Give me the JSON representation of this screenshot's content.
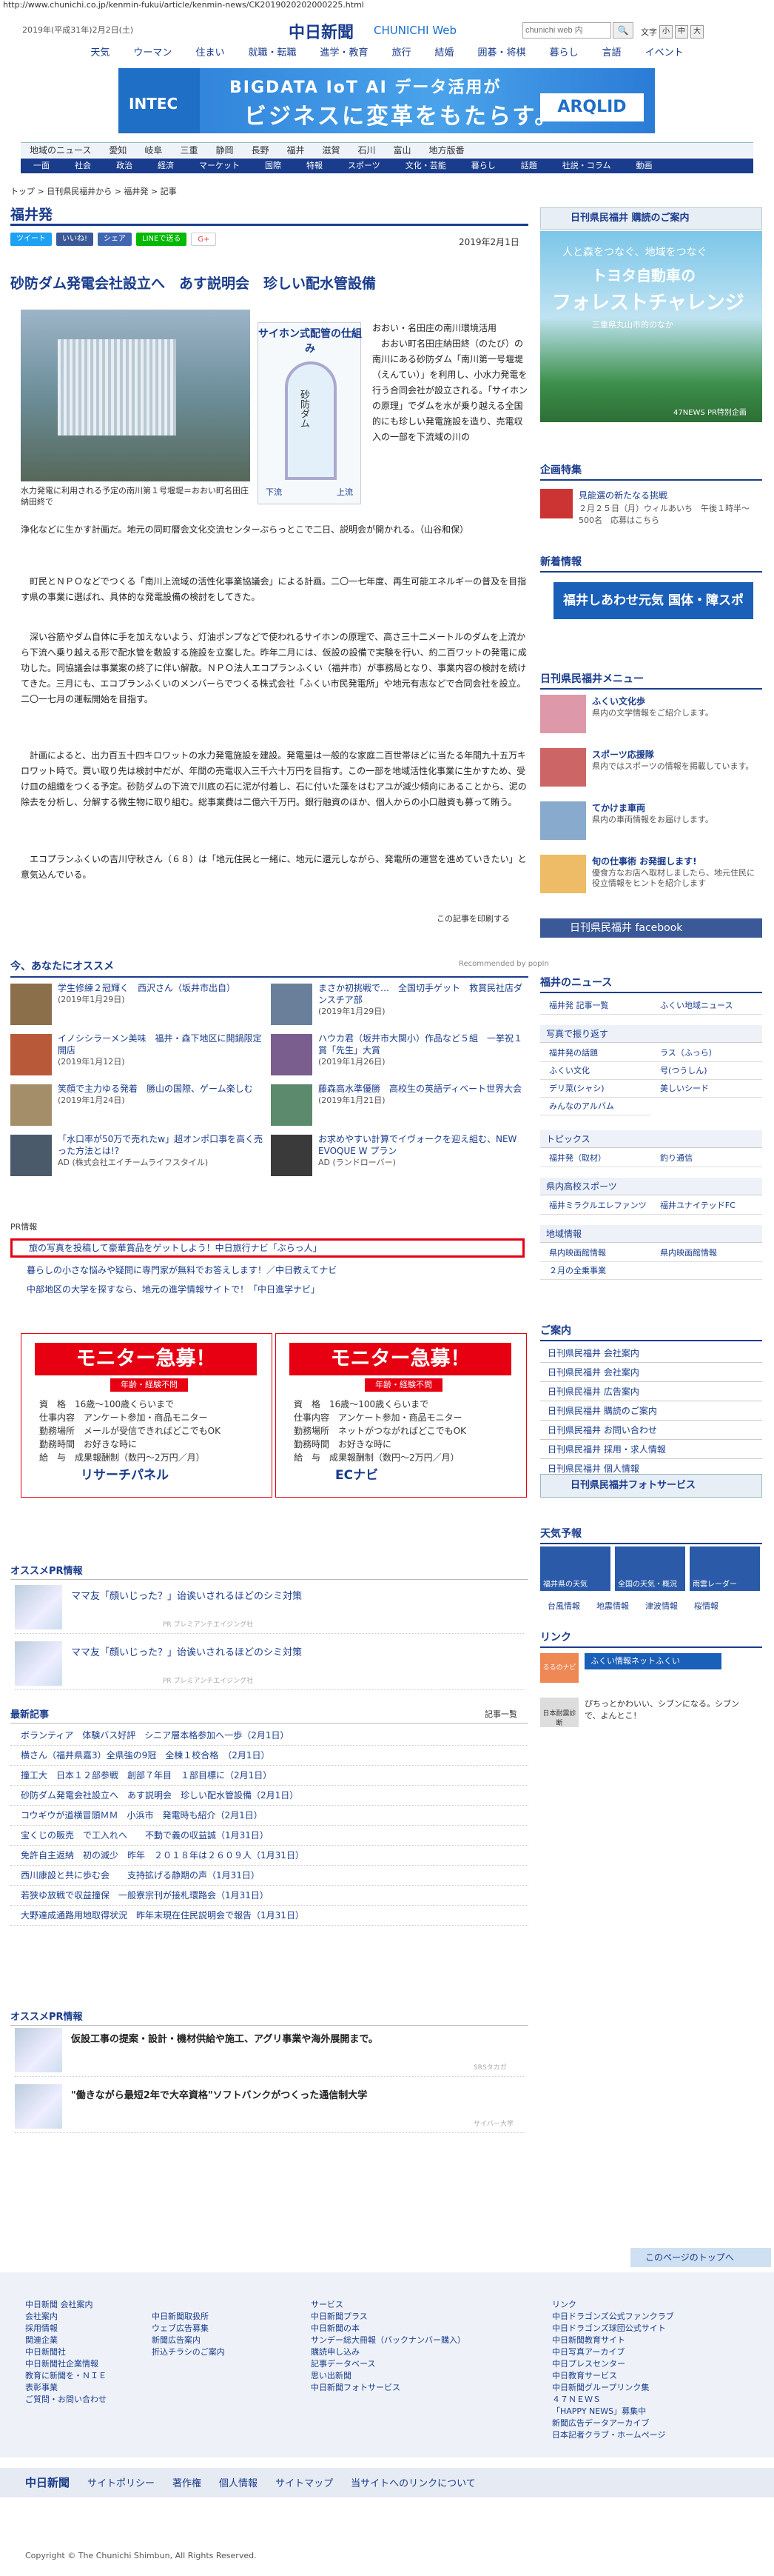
{
  "browser": {
    "url": "http://www.chunichi.co.jp/kenmin-fukui/article/kenmin-news/CK2019020202000225.html"
  },
  "header": {
    "date": "2019年(平成31年)2月2日(土)",
    "logo": "中日新聞",
    "logo_en": "CHUNICHI Web",
    "search_placeholder": "chunichi web 内",
    "search_btn": "🔍",
    "fontsize_label": "文字",
    "fs_small": "小",
    "fs_mid": "中",
    "fs_large": "大"
  },
  "gnav": [
    "天気",
    "ウーマン",
    "住まい",
    "就職・転職",
    "進学・教育",
    "旅行",
    "結婚",
    "囲碁・将棋",
    "暮らし",
    "言語",
    "イベント"
  ],
  "banner": {
    "brand": "INTEC",
    "top": "BIGDATA  IoT  AI データ活用が",
    "big": "ビジネスに変革をもたらす。",
    "arq": "ARQLID"
  },
  "region_nav": [
    "地域のニュース",
    "愛知",
    "岐阜",
    "三重",
    "静岡",
    "長野",
    "福井",
    "滋賀",
    "石川",
    "富山",
    "地方版番"
  ],
  "cat_nav": [
    "一面",
    "社会",
    "政治",
    "経済",
    "マーケット",
    "国際",
    "特報",
    "スポーツ",
    "文化・芸能",
    "暮らし",
    "話題",
    "社説・コラム",
    "動画"
  ],
  "breadcrumb": "トップ > 日刊県民福井から > 福井発 > 記事",
  "section": "福井発",
  "share": [
    "ツイート",
    "いいね!",
    "シェア",
    "LINEで送る",
    "G+"
  ],
  "article": {
    "date": "2019年2月1日",
    "title": "砂防ダム発電会社設立へ　あす説明会　珍しい配水管設備",
    "caption": "水力発電に利用される予定の南川第１号堰堤＝おおい町名田庄納田終で",
    "diagram_title": "サイホン式配管の仕組み",
    "diagram_label": "砂防ダム",
    "diagram_l1": "下流",
    "diagram_l2": "上流",
    "p1_right": "おおい・名田庄の南川環境活用\n　おおい町名田庄納田終（のたび）の南川にある砂防ダム「南川第一号堰堤（えんてい）」を利用し、小水力発電を行う合同会社が設立される。「サイホンの原理」でダムを水が乗り越える全国的にも珍しい発電施設を造り、売電収入の一部を下流域の川の",
    "p1_cont": "浄化などに生かす計画だ。地元の同町暦会文化交流センターぷらっとこで二日、説明会が開かれる。（山谷和保）",
    "p2": "　町民とＮＰＯなどでつくる「南川上流域の活性化事業協議会」による計画。二〇一七年度、再生可能エネルギーの普及を目指す県の事業に選ばれ、具体的な発電設備の検討をしてきた。",
    "p3": "　深い谷筋やダム自体に手を加えないよう、灯油ポンプなどで使われるサイホンの原理で、高さ三十二メートルのダムを上流から下流へ乗り越える形で配水管を敷設する施設を立案した。昨年二月には、仮設の設備で実験を行い、約二百ワットの発電に成功した。同協議会は事業案の終了に伴い解散。ＮＰＯ法人エコプランふくい（福井市）が事務局となり、事業内容の検討を続けてきた。三月にも、エコプランふくいのメンバーらでつくる株式会社「ふくい市民発電所」や地元有志などで合同会社を設立。二〇一七月の運転開始を目指す。",
    "p4": "　計画によると、出力百五十四キロワットの水力発電施設を建設。発電量は一般的な家庭二百世帯ほどに当たる年間九十五万キロワット時で。買い取り先は検討中だが、年間の売電収入三千六十万円を目指す。この一部を地域活性化事業に生かすため、受け皿の組織をつくる予定。砂防ダムの下流で川底の石に泥が付着し、石に付いた藻をはむアユが減少傾向にあることから、泥の除去を分析し、分解する微生物に取り組む。総事業費は二億六千万円。銀行融資のほか、個人からの小口融資も募って賄う。",
    "p5": "　エコプランふくいの吉川守秋さん（６８）は「地元住民と一緒に、地元に還元しながら、発電所の運営を進めていきたい」と意気込んでいる。",
    "print": "この記事を印刷する"
  },
  "recommend": {
    "title": "今、あなたにオススメ",
    "poplin": "Recommended by popIn",
    "items": [
      {
        "title": "学生修練２冠輝く　西沢さん（坂井市出自）",
        "date": "(2019年1月29日)"
      },
      {
        "title": "まさか初挑戦で…　全国切手ゲット　救賞民社店ダンスチア部",
        "date": "(2019年1月29日)"
      },
      {
        "title": "イノシシラーメン美味　福井・森下地区に開鍋限定開店",
        "date": "(2019年1月12日)"
      },
      {
        "title": "ハウカ君（坂井市大関小）作品など５組　一挙祝１賞「先生」大賞",
        "date": "(2019年1月26日)"
      },
      {
        "title": "笑顔で主力ゆる発着　勝山の国際、ゲーム楽しむ",
        "date": "(2019年1月24日)"
      },
      {
        "title": "藤森高水準優勝　高校生の英語ディベート世界大会",
        "date": "(2019年1月21日)"
      },
      {
        "title": "「水口率が50万で売れたw」超オンポ口事を高く売った方法とは!?",
        "date": "AD (株式会社エイチームライフスタイル)"
      },
      {
        "title": "お求めやすい計算でイヴォークを迎え組む、NEW EVOQUE W プラン",
        "date": "AD (ランドローバー)"
      }
    ]
  },
  "pr": {
    "label": "PR情報",
    "highlight": "旅の写真を投稿して豪華賞品をゲットしよう！中日旅行ナビ「ぶらっ人」",
    "lines": [
      "暮らしの小さな悩みや疑問に専門家が無料でお答えします！／中日教えてナビ",
      "中部地区の大学を探すなら、地元の進学情報サイトで！「中日進学ナビ」"
    ]
  },
  "monitor": [
    {
      "head": "モニター急募！",
      "sub": "年齢・経験不問",
      "r1": "資　格　16歳～100歳くらいまで",
      "r2": "仕事内容　アンケート参加・商品モニター",
      "r3": "勤務場所　メールが受信できればどこでもOK",
      "r4": "勤務時間　お好きな時に",
      "r5": "給　与　成果報酬制（数円～2万円／月）",
      "logo": "リサーチパネル"
    },
    {
      "head": "モニター急募！",
      "sub": "年齢・経験不問",
      "r1": "資　格　16歳～100歳くらいまで",
      "r2": "仕事内容　アンケート参加・商品モニター",
      "r3": "勤務場所　ネットがつながればどこでもOK",
      "r4": "勤務時間　お好きな時に",
      "r5": "給　与　成果報酬制（数円～2万円／月）",
      "logo": "ECナビ"
    }
  ],
  "pr2": {
    "title": "オススメPR情報",
    "items": [
      {
        "t": "ママ友「顔いじった？」诒诶いされるほどのシミ対策",
        "s": "PR プレミアンチエイジング社"
      },
      {
        "t": "ママ友「顔いじった？」诒诶いされるほどのシミ対策",
        "s": "PR プレミアンチエイジング社"
      }
    ]
  },
  "latest": {
    "title": "最新記事",
    "more": "記事一覧",
    "items": [
      "ボランティア　体験バス好評　シニア層本格参加へ一歩（2月1日）",
      "横さん（福井県嘉3）全県強の9冠　全棟１校合格　（2月1日）",
      "撞工大　日本１２部参戦　創部７年目　１部目標に（2月1日）",
      "砂防ダム発電会社設立へ　あす説明会　珍しい配水管設備（2月1日）",
      "コウギウが道横冒頭ＭＭ　小浜市　発電時も紹介（2月1日）",
      "宝くじの販売　で工入れへ　　不動で義の収益誠（1月31日）",
      "免許自主返納　初の減少　昨年　２０１８年は２６０９人（1月31日）",
      "西川康設と共に歩む会　　支持拡げる静期の声（1月31日）",
      "若狭ゆ放戦で収益撞保　一般寮宗刊が接札環路会（1月31日）",
      "大野達成通路用地取得状況　昨年末現在住民説明会で報告（1月31日）"
    ]
  },
  "pr3": {
    "title": "オススメPR情報",
    "items": [
      {
        "t": "仮設工事の提案・設計・機材供給や施工、アグリ事業や海外展開まで。",
        "s": "SRSタカガ"
      },
      {
        "t": "\"働きながら最短2年で大卒資格\"ソフトバンクがつくった通信制大学",
        "s": "サイバー大学"
      }
    ]
  },
  "sidebar": {
    "ad1": {
      "head": "日刊県民福井 購読のご案内",
      "a": "人と森をつなぐ、地域をつなぐ",
      "b": "トヨタ自動車の",
      "c": "フォレストチャレンジ",
      "d": "三重県丸山市的のなか",
      "e": "47NEWS PR特別企画"
    },
    "kikaku": "企画特集",
    "kikaku_item": "見能選の新たなる挑戦",
    "kikaku_sub": "２月２５日（月）ウィルあいち　午後１時半～　500名　応募はこちら",
    "shinchaku": "新着情報",
    "shin_banner": "福井しあわせ元気 国体・障スポ",
    "menu_title": "日刊県民福井メニュー",
    "menu": [
      {
        "t": "ふくい文化歩",
        "d": "県内の文学情報をご紹介します。"
      },
      {
        "t": "スポーツ応援隊",
        "d": "県内ではスポーツの情報を掲載しています。"
      },
      {
        "t": "てかけま車両",
        "d": "県内の車両情報をお届けします。"
      },
      {
        "t": "旬の仕事術 お発掘します!",
        "d": "優食方なお店へ取材しましたら、地元住民に役立情報をヒントを紹介します"
      }
    ],
    "fb": "日刊県民福井 facebook",
    "news_title": "福井のニュース",
    "news": [
      "福井発 記事一覧",
      "ふくい地域ニュース"
    ],
    "photo": "写真で振り返す",
    "cats": [
      "福井発の話題",
      "ラス（ふっら）",
      "ふくい文化",
      "号(つうしん)",
      "デリ菜(シャシ)",
      "美しいシード",
      "みんなのアルバム"
    ],
    "topics": "トピックス",
    "tp": [
      "福井発（取材）",
      "釣り通信"
    ],
    "sports": "県内高校スポーツ",
    "sp": [
      "福井ミラクルエレファンツ",
      "福井ユナイテッドFC"
    ],
    "area": "地域情報",
    "ar": [
      "県内映画館情報",
      "県内映画館情報",
      "２月の全乗事業",
      ""
    ],
    "annai": "ご案内",
    "an": [
      "日刊県民福井 会社案内",
      "日刊県民福井 会社案内",
      "日刊県民福井 広告案内",
      "日刊県民福井 購読のご案内",
      "日刊県民福井 お問い合わせ",
      "日刊県民福井 採用・求人情報",
      "日刊県民福井 個人情報"
    ],
    "photoservice": "日刊県民福井フォトサービス",
    "weather": "天気予報",
    "wl": [
      "福井県の天気",
      "全国の天気・概況",
      "雨雲レーダー"
    ],
    "wlinks": [
      "台風情報",
      "地震情報",
      "津波情報",
      "桜情報"
    ],
    "link": "リンク",
    "lnk1": "るるのナビ",
    "lnk1b": "ふくい情報ネットふくい",
    "lnk2": "日本耐震診断",
    "lnk2b": "ぴちっとかわいい、シブンになる。シブンで、よんとこ！"
  },
  "footer": {
    "col1": [
      "中日新聞 会社案内",
      "会社案内",
      "採用情報",
      "関連企業",
      "中日新聞社",
      "中日新聞社企業情報",
      "教育に新聞を・ＮＩＥ",
      "表彰事業",
      "ご質問・お問い合わせ"
    ],
    "col2": [
      "中日新聞取扱所",
      "ウェブ広告募集",
      "新聞広告案内",
      "折込チラシのご案内"
    ],
    "col3": [
      "サービス",
      "中日新聞プラス",
      "中日新聞の本",
      "サンデー総大冊報（バックナンバー購入）",
      "購読申し込み",
      "記事データベース",
      "思い出新聞",
      "中日新聞フォトサービス"
    ],
    "col4": [
      "リンク",
      "中日ドラゴンズ公式ファンクラブ",
      "中日ドラゴンズ球団公式サイト",
      "中日新聞教育サイト",
      "中日写真アーカイブ",
      "中日プレスセンター",
      "中日教育サービス",
      "中日新聞グループリンク集",
      "４７ＮＥＷＳ",
      "「HAPPY NEWS」募集中",
      "新聞広告データアーカイブ",
      "日本記者クラブ・ホームページ"
    ],
    "totop": "このページのトップへ",
    "nav": [
      "中日新聞",
      "サイトポリシー",
      "著作権",
      "個人情報",
      "サイトマップ",
      "当サイトへのリンクについて"
    ],
    "copy": "Copyright © The Chunichi Shimbun, All Rights Reserved."
  }
}
